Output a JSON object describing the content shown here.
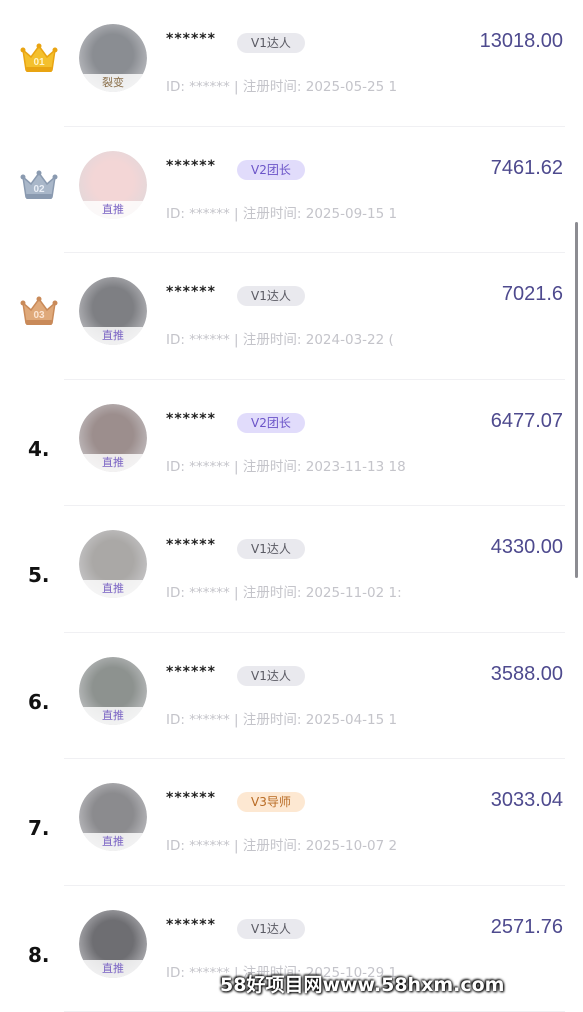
{
  "ranking": {
    "rows": [
      {
        "rank_label": "01",
        "crown": "gold",
        "avatar_tag": "裂变",
        "name": "******",
        "badge": "V1达人",
        "level": "v1",
        "id_label": "ID:",
        "id_value": "******",
        "divider": "|",
        "reg_label": "注册时间:",
        "reg_time": "2025-05-25 1",
        "amount": "13018.00",
        "avatar_color": "#8a8d92"
      },
      {
        "rank_label": "02",
        "crown": "silver",
        "avatar_tag": "直推",
        "name": "******",
        "badge": "V2团长",
        "level": "v2",
        "id_label": "ID:",
        "id_value": "******",
        "divider": "|",
        "reg_label": "注册时间:",
        "reg_time": "2025-09-15 1",
        "amount": "7461.62",
        "avatar_color": "#f3d6d6"
      },
      {
        "rank_label": "03",
        "crown": "bronze",
        "avatar_tag": "直推",
        "name": "******",
        "badge": "V1达人",
        "level": "v1",
        "id_label": "ID:",
        "id_value": "******",
        "divider": "|",
        "reg_label": "注册时间:",
        "reg_time": "2024-03-22 (",
        "amount": "7021.6",
        "avatar_color": "#7e7f83"
      },
      {
        "rank_label": "4.",
        "crown": "",
        "avatar_tag": "直推",
        "name": "******",
        "badge": "V2团长",
        "level": "v2",
        "id_label": "ID:",
        "id_value": "******",
        "divider": "|",
        "reg_label": "注册时间:",
        "reg_time": "2023-11-13 18",
        "amount": "6477.07",
        "avatar_color": "#9c8e8d"
      },
      {
        "rank_label": "5.",
        "crown": "",
        "avatar_tag": "直推",
        "name": "******",
        "badge": "V1达人",
        "level": "v1",
        "id_label": "ID:",
        "id_value": "******",
        "divider": "|",
        "reg_label": "注册时间:",
        "reg_time": "2025-11-02 1:",
        "amount": "4330.00",
        "avatar_color": "#aaa8a6"
      },
      {
        "rank_label": "6.",
        "crown": "",
        "avatar_tag": "直推",
        "name": "******",
        "badge": "V1达人",
        "level": "v1",
        "id_label": "ID:",
        "id_value": "******",
        "divider": "|",
        "reg_label": "注册时间:",
        "reg_time": "2025-04-15 1",
        "amount": "3588.00",
        "avatar_color": "#8d928f"
      },
      {
        "rank_label": "7.",
        "crown": "",
        "avatar_tag": "直推",
        "name": "******",
        "badge": "V3导师",
        "level": "v3",
        "id_label": "ID:",
        "id_value": "******",
        "divider": "|",
        "reg_label": "注册时间:",
        "reg_time": "2025-10-07 2",
        "amount": "3033.04",
        "avatar_color": "#8b8b8e"
      },
      {
        "rank_label": "8.",
        "crown": "",
        "avatar_tag": "直推",
        "name": "******",
        "badge": "V1达人",
        "level": "v1",
        "id_label": "ID:",
        "id_value": "******",
        "divider": "|",
        "reg_label": "注册时间:",
        "reg_time": "2025-10-29 1",
        "amount": "2571.76",
        "avatar_color": "#6e6e72"
      }
    ]
  },
  "watermark": "58好项目网www.58hxm.com",
  "colors": {
    "amount": "#4e4a8e",
    "v2_badge": "#e1dcfb",
    "v3_badge": "#fde8d2",
    "v1_badge": "#e9e9ee"
  }
}
